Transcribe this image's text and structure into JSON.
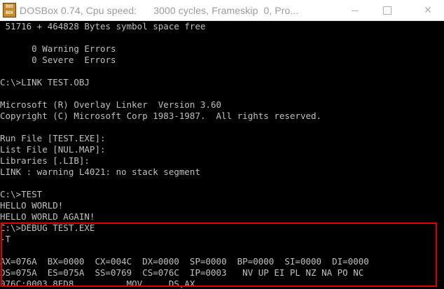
{
  "window": {
    "title": "DOSBox 0.74, Cpu speed:      3000 cycles, Frameskip  0, Pro...",
    "icon_text": [
      "DOS",
      "BOX"
    ],
    "icon_name": "dosbox-app-icon",
    "controls": {
      "minimize": "minimize-icon",
      "maximize": "maximize-icon",
      "close": "✕"
    }
  },
  "console": {
    "text_color": "#c0c0c0",
    "background": "#000000",
    "lines": [
      " 51716 + 464828 Bytes symbol space free",
      "",
      "      0 Warning Errors",
      "      0 Severe  Errors",
      "",
      "C:\\>LINK TEST.OBJ",
      "",
      "Microsoft (R) Overlay Linker  Version 3.60",
      "Copyright (C) Microsoft Corp 1983-1987.  All rights reserved.",
      "",
      "Run File [TEST.EXE]:",
      "List File [NUL.MAP]:",
      "Libraries [.LIB]:",
      "LINK : warning L4021: no stack segment",
      "",
      "C:\\>TEST",
      "HELLO WORLD!",
      "HELLO WORLD AGAIN!",
      "C:\\>DEBUG TEST.EXE",
      "-T",
      "",
      "AX=076A  BX=0000  CX=004C  DX=0000  SP=0000  BP=0000  SI=0000  DI=0000",
      "DS=075A  ES=075A  SS=0769  CS=076C  IP=0003   NV UP EI PL NZ NA PO NC",
      "076C:0003 8ED8          MOV     DS,AX"
    ]
  },
  "annotation": {
    "highlight_color": "#e00000"
  }
}
